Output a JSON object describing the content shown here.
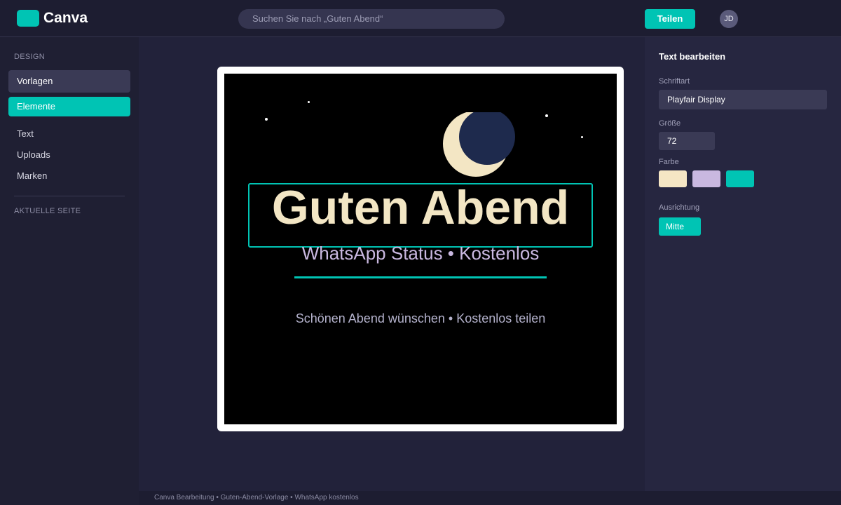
{
  "header": {
    "logo_text": "Canva",
    "search_placeholder": "Suchen Sie nach „Guten Abend“",
    "share_label": "Teilen",
    "avatar_initials": "JD"
  },
  "sidebar": {
    "section_design": "DESIGN",
    "items": [
      {
        "label": "Vorlagen",
        "state": "hover"
      },
      {
        "label": "Elemente",
        "state": "active"
      },
      {
        "label": "Text"
      },
      {
        "label": "Uploads"
      },
      {
        "label": "Marken"
      }
    ],
    "section_current_page": "AKTUELLE SEITE"
  },
  "design": {
    "headline": "Guten Abend",
    "subheadline": "WhatsApp Status • Kostenlos",
    "tagline": "Schönen Abend wünschen • Kostenlos teilen",
    "background_color": "#000000",
    "moon_color": "#f3e6c4",
    "moon_shadow_color": "#1e2a4d",
    "headline_color": "#f3e6c4",
    "subheadline_color": "#c9b8e0",
    "accent_color": "#00c4b4"
  },
  "panel": {
    "title": "Text bearbeiten",
    "font_label": "Schriftart",
    "font_value": "Playfair Display",
    "size_label": "Größe",
    "size_value": "72",
    "color_label": "Farbe",
    "swatches": [
      "#f5e6c4",
      "#c9b8e0",
      "#00c4b4"
    ],
    "align_label": "Ausrichtung",
    "align_value": "Mitte"
  },
  "footer": {
    "text": "Canva Bearbeitung • Guten-Abend-Vorlage • WhatsApp kostenlos"
  },
  "colors": {
    "accent": "#00c4b4",
    "header_bg": "#1d1d31",
    "sidebar_bg": "#1f1f33",
    "canvas_bg": "#22223a",
    "panel_bg": "#262640"
  },
  "icons": {
    "logo": "canva-logo-mark",
    "moon": "crescent-moon-icon",
    "stars": "star-dot-icon"
  }
}
